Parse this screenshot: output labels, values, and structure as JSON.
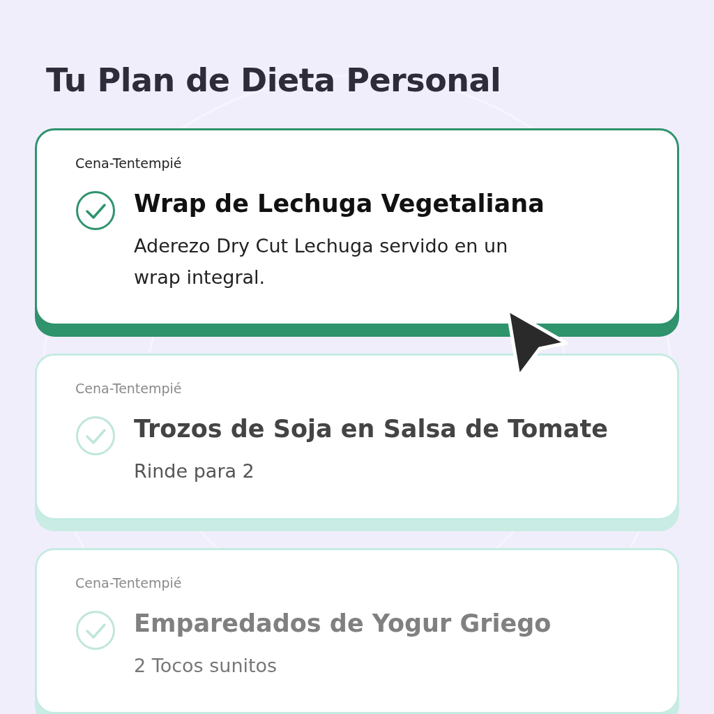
{
  "title": "Tu Plan de Dieta Personal",
  "meals": [
    {
      "category": "Cena-Tentempié",
      "name": "Wrap de Lechuga Vegetaliana",
      "detail": "Aderezo Dry Cut Lechuga servido en un wrap integral.",
      "selected": true,
      "faded": false
    },
    {
      "category": "Cena-Tentempié",
      "name": "Trozos de Soja en Salsa de Tomate",
      "detail": "Rinde para 2",
      "selected": false,
      "faded": false
    },
    {
      "category": "Cena-Tentempié",
      "name": "Emparedados de Yogur Griego",
      "detail": "2 Tocos sunitos",
      "selected": false,
      "faded": true
    }
  ]
}
